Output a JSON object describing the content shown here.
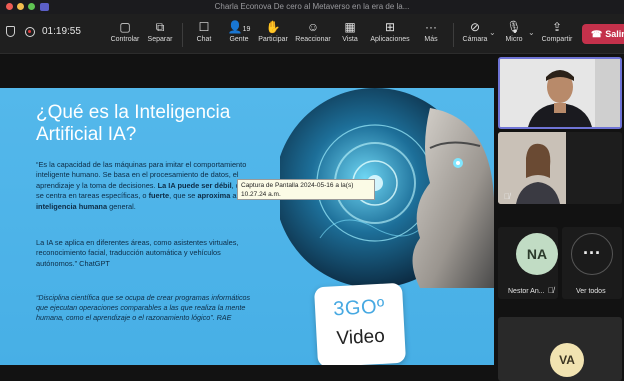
{
  "window": {
    "title": "Charla Econova De cero al Metaverso en la era de la..."
  },
  "toolbar": {
    "timer": "01:19:55",
    "buttons": [
      {
        "label": "Controlar",
        "icon": "share-control-icon"
      },
      {
        "label": "Separar",
        "icon": "pop-out-icon"
      },
      {
        "label": "Chat",
        "icon": "chat-icon"
      },
      {
        "label": "Gente",
        "icon": "people-icon",
        "badge": "19"
      },
      {
        "label": "Participar",
        "icon": "raise-hand-icon"
      },
      {
        "label": "Reaccionar",
        "icon": "reaction-icon"
      },
      {
        "label": "Vista",
        "icon": "view-icon"
      },
      {
        "label": "Aplicaciones",
        "icon": "apps-icon"
      },
      {
        "label": "Más",
        "icon": "more-icon"
      }
    ],
    "camera_label": "Cámara",
    "mic_label": "Micro",
    "share_label": "Compartir",
    "leave_label": "Salir"
  },
  "slide": {
    "title": "¿Qué es la Inteligencia Artificial IA?",
    "p1_a": "“Es la capacidad de las máquinas para imitar el comportamiento inteligente humano. Se basa en el procesamiento de datos, el aprendizaje y la toma de decisiones. ",
    "p1_b": "La IA puede ser débil",
    "p1_c": ", que se centra en tareas específicas, o ",
    "p1_d": "fuerte",
    "p1_e": ", que se ",
    "p1_f": "aproxima",
    "p1_g": " a la ",
    "p1_h": "inteligencia humana",
    "p1_i": " general.",
    "p2": "La IA se aplica en diferentes áreas, como asistentes virtuales, reconocimiento facial, traducción automática y vehículos autónomos.” ChatGPT",
    "p3": "“Disciplina científica que se ocupa de crear programas informáticos que ejecutan operaciones comparables a las que realiza la mente humana, como el aprendizaje o el razonamiento lógico”. RAE",
    "logo_top": "3GOº",
    "logo_bottom": "Video",
    "tooltip": "Captura de Pantalla 2024-05-16 a la(s) 10.27.24 a.m."
  },
  "participants": [
    {
      "initials": "NA",
      "name": "Nestor An...",
      "muted": true
    },
    {
      "name": "Ver todos",
      "icon": "more-icon"
    },
    {
      "initials": "VA"
    }
  ],
  "colors": {
    "slide_bg": "#4fb5e9",
    "leave_red": "#c4314b",
    "active_speaker": "#6f74d6",
    "avatar_na": "#c1dcc4",
    "avatar_va": "#f1e3b1"
  }
}
